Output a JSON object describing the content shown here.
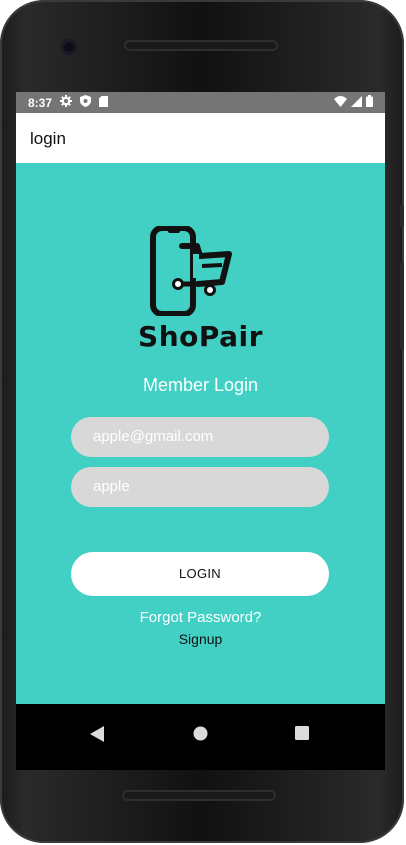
{
  "status_bar": {
    "time": "8:37",
    "left_icons": [
      "gear-icon",
      "shield-icon",
      "sd-card-icon"
    ],
    "right_icons": [
      "wifi-icon",
      "signal-icon",
      "battery-icon"
    ]
  },
  "app_bar": {
    "title": "login"
  },
  "colors": {
    "accent": "#42D0C4",
    "field": "#D8D8D8",
    "status_bar": "#757575"
  },
  "logo": {
    "text": "ShoPair",
    "icon": "phone-cart-icon"
  },
  "form": {
    "heading": "Member Login",
    "email_value": "apple@gmail.com",
    "password_value": "apple",
    "login_label": "LOGIN",
    "forgot_label": "Forgot Password?",
    "signup_label": "Signup"
  },
  "nav": {
    "icons": [
      "back-icon",
      "home-icon",
      "recents-icon"
    ]
  }
}
